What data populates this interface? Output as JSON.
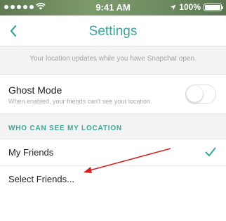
{
  "status_bar": {
    "time": "9:41 AM",
    "battery": "100%",
    "battery_level": 1.0
  },
  "header": {
    "title": "Settings",
    "back_icon": "chevron-left-icon"
  },
  "location_note": "Your location updates while you have Snapchat open.",
  "ghost_mode": {
    "label": "Ghost Mode",
    "description": "When enabled, your friends can't see your location.",
    "enabled": false
  },
  "section": {
    "title": "WHO CAN SEE MY LOCATION"
  },
  "options": [
    {
      "label": "My Friends",
      "selected": true
    },
    {
      "label": "Select Friends...",
      "selected": false
    }
  ],
  "colors": {
    "accent": "#3aa59b",
    "annotation": "#d32020"
  }
}
